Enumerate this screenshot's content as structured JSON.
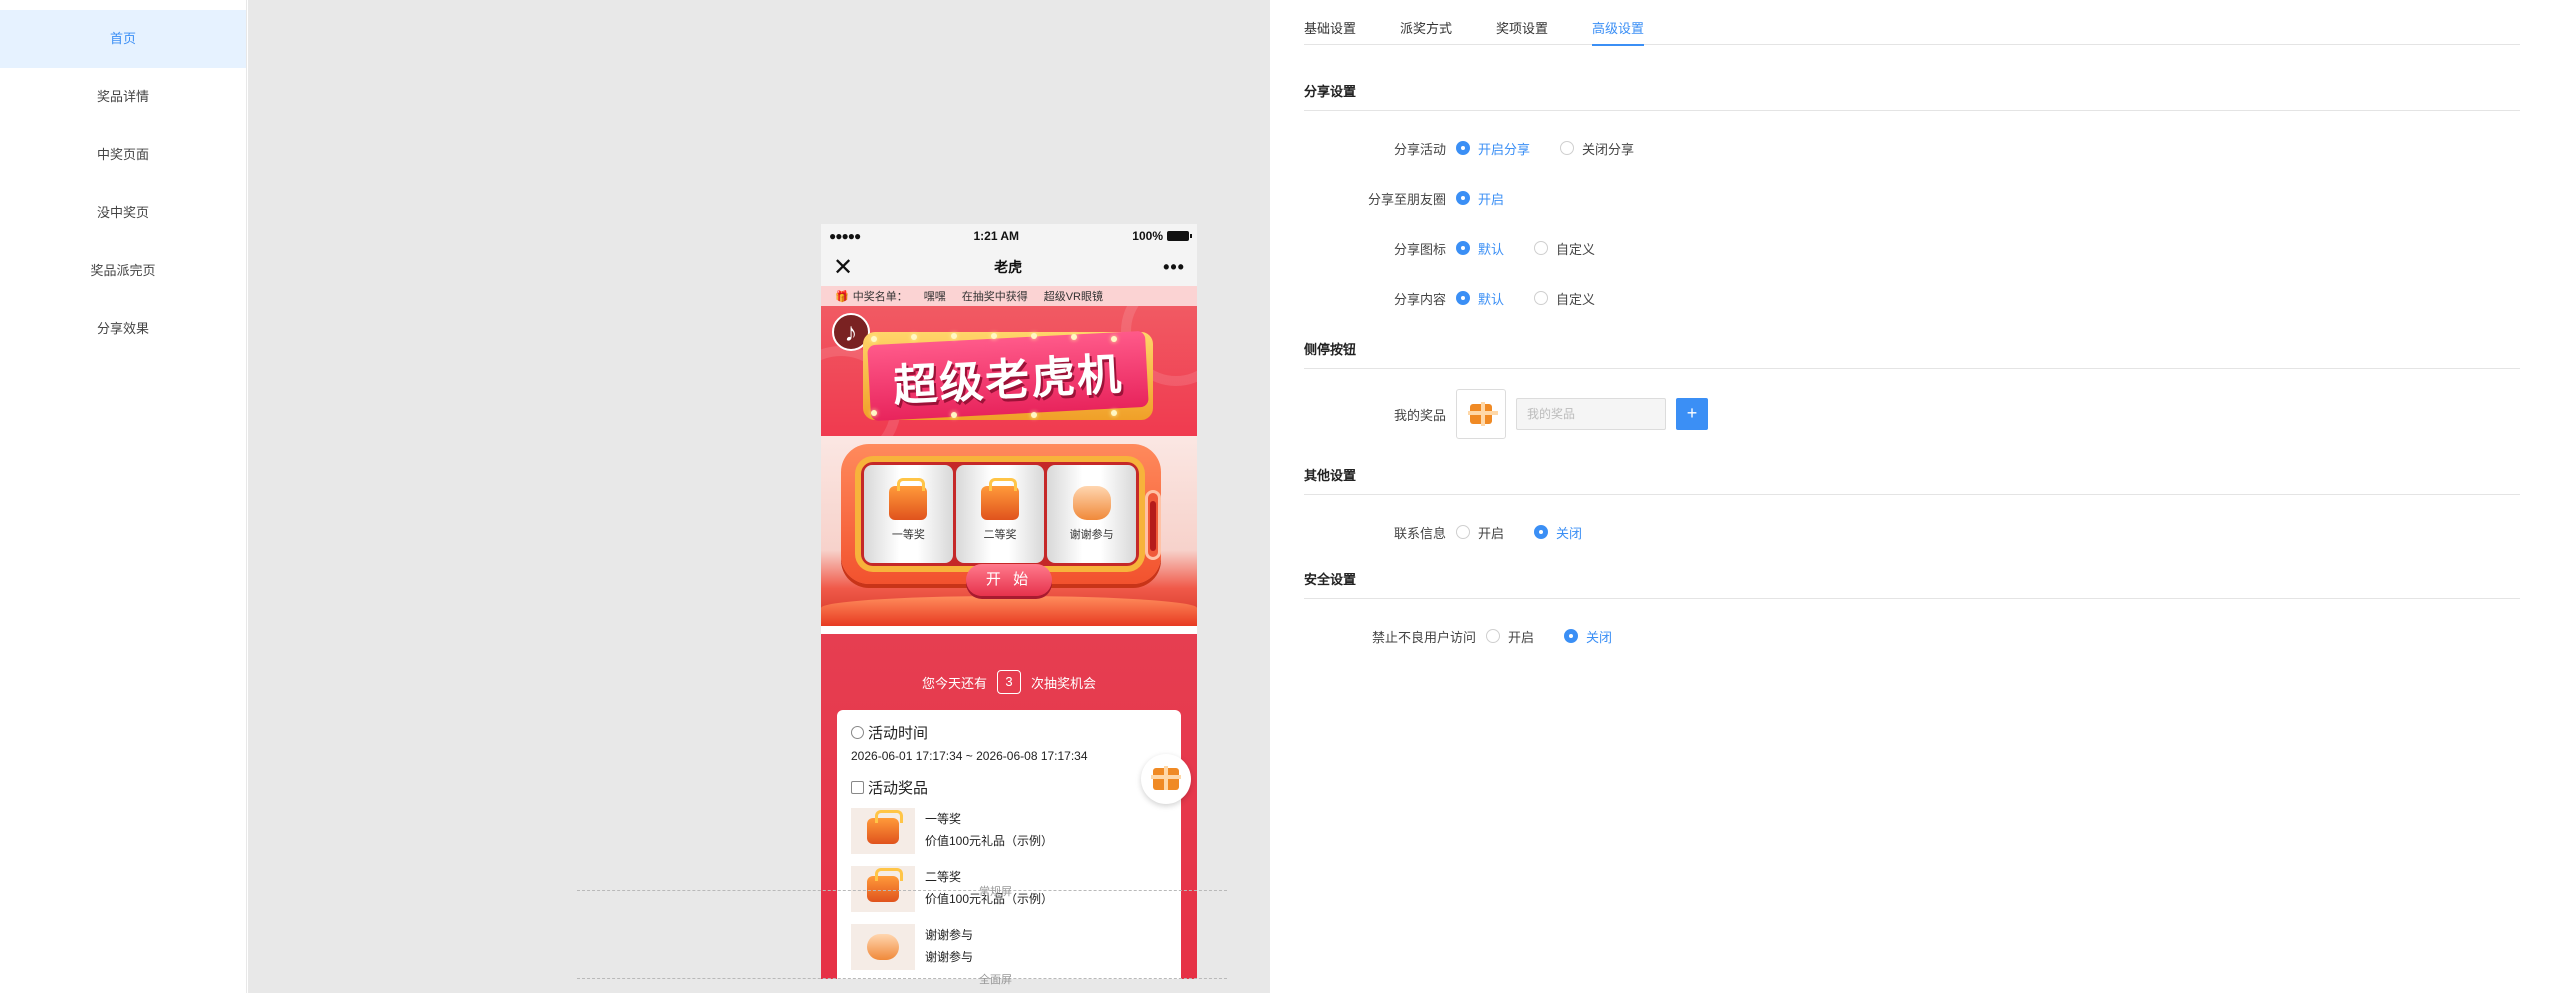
{
  "sidebar": {
    "items": [
      {
        "label": "首页"
      },
      {
        "label": "奖品详情"
      },
      {
        "label": "中奖页面"
      },
      {
        "label": "没中奖页"
      },
      {
        "label": "奖品派完页"
      },
      {
        "label": "分享效果"
      }
    ],
    "active_index": 0
  },
  "canvas": {
    "guide_normal_label": "常规屏",
    "guide_full_label": "全面屏"
  },
  "phone": {
    "status": {
      "signal": "●●●●●",
      "time": "1:21 AM",
      "battery": "100%"
    },
    "nav": {
      "title": "老虎",
      "close_icon": "close-icon",
      "more_icon": "more-icon"
    },
    "ticker": {
      "head": "中奖名单：",
      "name": "嘿嘿",
      "action": "在抽奖中获得",
      "prize": "超级VR眼镜"
    },
    "banner_title": "超级老虎机",
    "reels": [
      {
        "label": "一等奖"
      },
      {
        "label": "二等奖"
      },
      {
        "label": "谢谢参与"
      }
    ],
    "start_label": "开 始",
    "chance": {
      "prefix": "您今天还有",
      "count": "3",
      "suffix": "次抽奖机会"
    },
    "activity_time": {
      "title": "活动时间",
      "value": "2026-06-01 17:17:34 ~ 2026-06-08 17:17:34"
    },
    "activity_prizes": {
      "title": "活动奖品",
      "items": [
        {
          "name": "一等奖",
          "desc": "价值100元礼品（示例）"
        },
        {
          "name": "二等奖",
          "desc": "价值100元礼品（示例）"
        },
        {
          "name": "谢谢参与",
          "desc": "谢谢参与"
        }
      ]
    }
  },
  "panel": {
    "tabs": [
      {
        "label": "基础设置"
      },
      {
        "label": "派奖方式"
      },
      {
        "label": "奖项设置"
      },
      {
        "label": "高级设置"
      }
    ],
    "active_tab": 3,
    "share": {
      "section": "分享设置",
      "activity": {
        "label": "分享活动",
        "on": "开启分享",
        "off": "关闭分享",
        "selected": "on"
      },
      "moments": {
        "label": "分享至朋友圈",
        "on": "开启",
        "selected": "on"
      },
      "icon": {
        "label": "分享图标",
        "default": "默认",
        "custom": "自定义",
        "selected": "default"
      },
      "content": {
        "label": "分享内容",
        "default": "默认",
        "custom": "自定义",
        "selected": "default"
      }
    },
    "side_button": {
      "section": "侧停按钮",
      "my_prize": {
        "label": "我的奖品",
        "placeholder": "我的奖品",
        "add": "+"
      }
    },
    "other": {
      "section": "其他设置",
      "contact": {
        "label": "联系信息",
        "on": "开启",
        "off": "关闭",
        "selected": "off"
      }
    },
    "security": {
      "section": "安全设置",
      "block": {
        "label": "禁止不良用户访问",
        "on": "开启",
        "off": "关闭",
        "selected": "off"
      }
    },
    "accent_color": "#3b8ff5"
  }
}
